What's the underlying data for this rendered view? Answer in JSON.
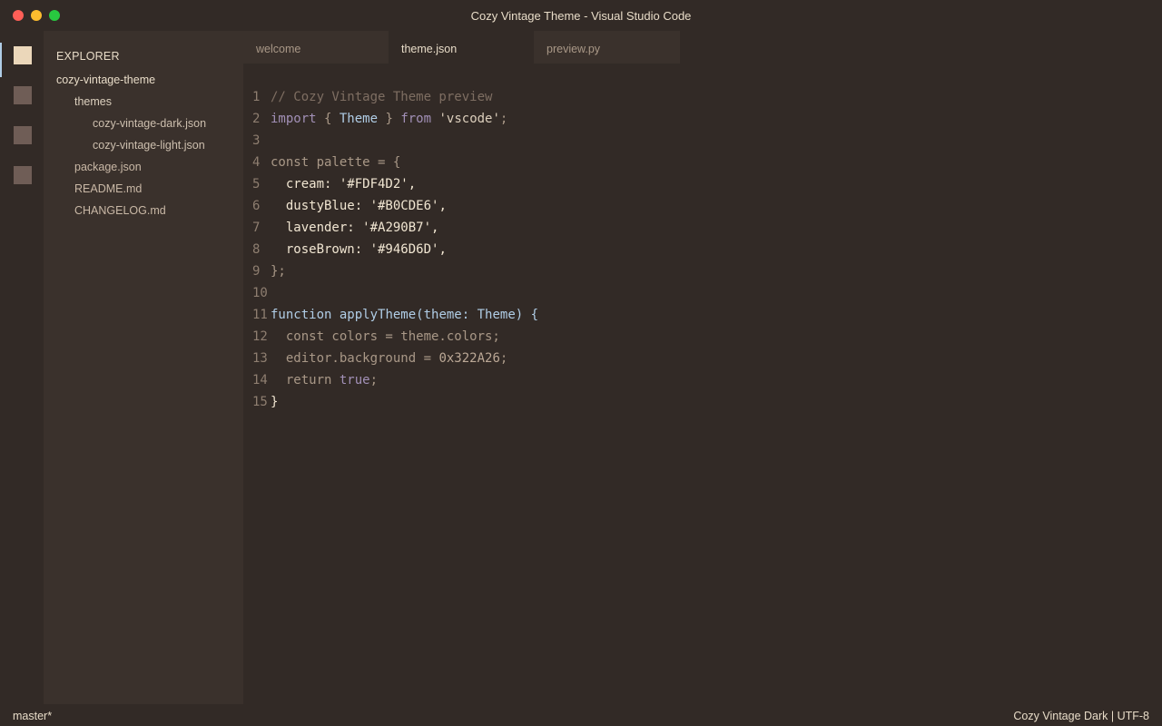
{
  "window": {
    "title": "Cozy Vintage Theme - Visual Studio Code"
  },
  "activity_bar": {
    "items": [
      {
        "icon": "files-icon",
        "active": true
      },
      {
        "icon": "search-icon",
        "active": false
      },
      {
        "icon": "source-control-icon",
        "active": false
      },
      {
        "icon": "extensions-icon",
        "active": false
      }
    ]
  },
  "sidebar": {
    "title": "EXPLORER",
    "root": "cozy-vintage-theme",
    "folders": [
      {
        "label": "themes",
        "files": [
          "cozy-vintage-dark.json",
          "cozy-vintage-light.json"
        ]
      }
    ],
    "files": [
      "package.json",
      "README.md",
      "CHANGELOG.md"
    ]
  },
  "tabs": [
    {
      "label": "welcome",
      "active": false
    },
    {
      "label": "theme.json",
      "active": true
    },
    {
      "label": "preview.py",
      "active": false
    }
  ],
  "editor": {
    "line_numbers": [
      "1",
      "2",
      "3",
      "4",
      "5",
      "6",
      "7",
      "8",
      "9",
      "10",
      "11",
      "12",
      "13",
      "14",
      "15"
    ],
    "lines": [
      [
        {
          "t": "// Cozy Vintage Theme preview",
          "c": "cm"
        }
      ],
      [
        {
          "t": "import",
          "c": "kw"
        },
        {
          "t": " { ",
          "c": "pl"
        },
        {
          "t": "Theme",
          "c": "ty"
        },
        {
          "t": " } ",
          "c": "pl"
        },
        {
          "t": "from",
          "c": "kw"
        },
        {
          "t": " ",
          "c": "pl"
        },
        {
          "t": "'vscode'",
          "c": "st"
        },
        {
          "t": ";",
          "c": "pl"
        }
      ],
      [],
      [
        {
          "t": "const palette = {",
          "c": "pl"
        }
      ],
      [
        {
          "t": "  cream: ",
          "c": "pr"
        },
        {
          "t": "'#FDF4D2'",
          "c": "pr"
        },
        {
          "t": ",",
          "c": "pr"
        }
      ],
      [
        {
          "t": "  dustyBlue: ",
          "c": "pr"
        },
        {
          "t": "'#B0CDE6'",
          "c": "pr"
        },
        {
          "t": ",",
          "c": "pr"
        }
      ],
      [
        {
          "t": "  lavender: ",
          "c": "pr"
        },
        {
          "t": "'#A290B7'",
          "c": "pr"
        },
        {
          "t": ",",
          "c": "pr"
        }
      ],
      [
        {
          "t": "  roseBrown: ",
          "c": "pr"
        },
        {
          "t": "'#946D6D'",
          "c": "pr"
        },
        {
          "t": ",",
          "c": "pr"
        }
      ],
      [
        {
          "t": "};",
          "c": "pl"
        }
      ],
      [],
      [
        {
          "t": "function",
          "c": "fn"
        },
        {
          "t": " applyTheme(",
          "c": "fn"
        },
        {
          "t": "theme",
          "c": "fn"
        },
        {
          "t": ": ",
          "c": "fn"
        },
        {
          "t": "Theme",
          "c": "fn"
        },
        {
          "t": ") {",
          "c": "fn"
        }
      ],
      [
        {
          "t": "  const colors = theme.colors;",
          "c": "pl"
        }
      ],
      [
        {
          "t": "  editor.background = ",
          "c": "pl"
        },
        {
          "t": "0x322A26",
          "c": "nm"
        },
        {
          "t": ";",
          "c": "pl"
        }
      ],
      [
        {
          "t": "  return ",
          "c": "pl"
        },
        {
          "t": "true",
          "c": "kw"
        },
        {
          "t": ";",
          "c": "pl"
        }
      ],
      [
        {
          "t": "}",
          "c": "pr"
        }
      ]
    ]
  },
  "status_bar": {
    "branch": "master*",
    "right": "Cozy Vintage Dark | UTF-8"
  },
  "colors": {
    "background": "#322A26",
    "sidebar": "#3A312C",
    "accent": "#B0CDE6",
    "cream": "#EBD7BA",
    "lavender": "#A290B7"
  }
}
